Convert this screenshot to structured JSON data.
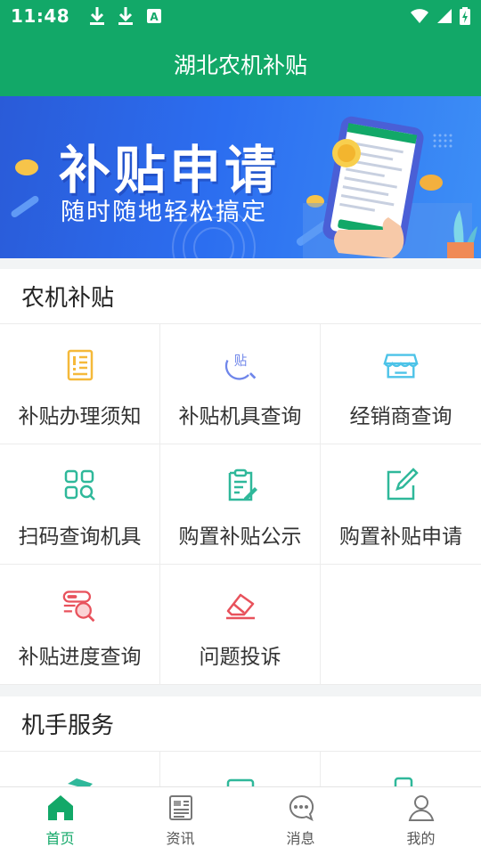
{
  "status_bar": {
    "time": "11:48",
    "notification_icons": [
      "download-icon",
      "download-icon",
      "text-a-icon"
    ],
    "system_icons": [
      "wifi-icon",
      "signal-icon",
      "battery-charging-icon"
    ]
  },
  "app_bar": {
    "title": "湖北农机补贴"
  },
  "banner": {
    "title": "补贴申请",
    "subtitle": "随时随地轻松搞定"
  },
  "sections": [
    {
      "title": "农机补贴",
      "items": [
        {
          "label": "补贴办理须知",
          "icon": "notice-document-icon"
        },
        {
          "label": "补贴机具查询",
          "icon": "subsidy-search-icon"
        },
        {
          "label": "经销商查询",
          "icon": "store-icon"
        },
        {
          "label": "扫码查询机具",
          "icon": "scan-grid-icon"
        },
        {
          "label": "购置补贴公示",
          "icon": "clipboard-edit-icon"
        },
        {
          "label": "购置补贴申请",
          "icon": "edit-form-icon"
        },
        {
          "label": "补贴进度查询",
          "icon": "progress-search-icon"
        },
        {
          "label": "问题投诉",
          "icon": "eraser-complaint-icon"
        }
      ]
    },
    {
      "title": "机手服务"
    }
  ],
  "tab_bar": {
    "items": [
      {
        "label": "首页",
        "icon": "home-icon",
        "active": true
      },
      {
        "label": "资讯",
        "icon": "news-icon",
        "active": false
      },
      {
        "label": "消息",
        "icon": "message-icon",
        "active": false
      },
      {
        "label": "我的",
        "icon": "user-icon",
        "active": false
      }
    ]
  },
  "colors": {
    "primary": "#12a868",
    "banner_blue": "#2c6ef0",
    "icon_orange": "#f5b93a",
    "icon_blue": "#6f86ea",
    "icon_cyan": "#4cc3e8",
    "icon_green": "#2fb89a",
    "icon_red": "#e8525c"
  }
}
